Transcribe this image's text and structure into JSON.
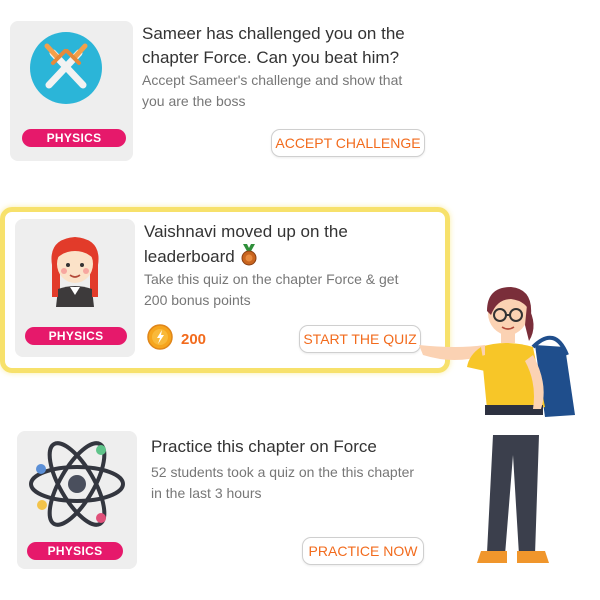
{
  "cards": [
    {
      "title": "Sameer has challenged you on the chapter Force. Can you beat him?",
      "description": "Accept Sameer's challenge and show that you are the boss",
      "badge": "PHYSICS",
      "action_label": "ACCEPT CHALLENGE",
      "icon": "crossed-swords-icon"
    },
    {
      "title": "Vaishnavi moved up on the leaderboard",
      "description": "Take this quiz on the chapter Force & get 200 bonus points",
      "badge": "PHYSICS",
      "points": "200",
      "action_label": "START THE QUIZ",
      "icon": "girl-avatar-icon"
    },
    {
      "title": "Practice this chapter on Force",
      "description": "52 students took a quiz on the this chapter in the last 3 hours",
      "badge": "PHYSICS",
      "action_label": "PRACTICE NOW",
      "icon": "atom-icon"
    }
  ],
  "colors": {
    "badge": "#e6196b",
    "accent": "#f26b1d",
    "highlight": "#f7e16b",
    "icon_circle": "#2bb5d8"
  }
}
